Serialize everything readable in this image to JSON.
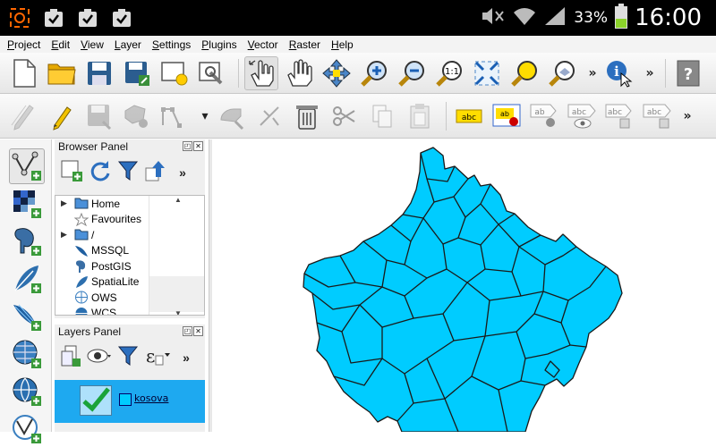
{
  "status_bar": {
    "time": "16:00",
    "battery_percent": "33%",
    "icons": [
      "gps-icon",
      "clipboard-icon",
      "clipboard-icon",
      "clipboard-icon",
      "mute-icon",
      "wifi-icon",
      "signal-icon",
      "battery-icon"
    ]
  },
  "menu": {
    "items": [
      {
        "label": "Project"
      },
      {
        "label": "Edit"
      },
      {
        "label": "View"
      },
      {
        "label": "Layer"
      },
      {
        "label": "Settings"
      },
      {
        "label": "Plugins"
      },
      {
        "label": "Vector"
      },
      {
        "label": "Raster"
      },
      {
        "label": "Help"
      }
    ]
  },
  "toolbar1": {
    "buttons": [
      "new-project-icon",
      "open-project-icon",
      "save-project-icon",
      "save-as-icon",
      "new-print-composer-icon",
      "composer-manager-icon",
      "touch-zoom-icon",
      "pan-icon",
      "pan-to-selection-icon",
      "zoom-in-icon",
      "zoom-out-icon",
      "zoom-actual-size-icon",
      "zoom-full-icon",
      "zoom-to-selection-icon",
      "zoom-to-layer-icon",
      "identify-icon",
      "help-icon"
    ],
    "more_label": "»"
  },
  "toolbar2": {
    "buttons": [
      "current-edits-icon",
      "toggle-editing-icon",
      "save-edits-icon",
      "add-feature-icon",
      "move-feature-icon",
      "node-tool-icon",
      "delete-selected-icon",
      "cut-features-icon",
      "copy-features-icon",
      "paste-features-icon",
      "label-icon",
      "layer-labeling-icon",
      "pin-labels-icon",
      "show-hide-labels-icon",
      "move-label-icon",
      "rotate-label-icon"
    ],
    "more_label": "»"
  },
  "left_toolbar": {
    "buttons": [
      "add-vector-layer-icon",
      "add-raster-layer-icon",
      "add-postgis-layer-icon",
      "add-spatialite-layer-icon",
      "add-mssql-layer-icon",
      "add-wms-layer-icon",
      "add-wcs-layer-icon",
      "add-wfs-layer-icon"
    ]
  },
  "browser_panel": {
    "title": "Browser Panel",
    "more_label": "»",
    "items": [
      {
        "label": "Home",
        "icon": "folder-icon",
        "expandable": true
      },
      {
        "label": "Favourites",
        "icon": "star-icon",
        "expandable": false
      },
      {
        "label": "/",
        "icon": "folder-icon",
        "expandable": true
      },
      {
        "label": "MSSQL",
        "icon": "mssql-icon",
        "expandable": false
      },
      {
        "label": "PostGIS",
        "icon": "postgis-icon",
        "expandable": false
      },
      {
        "label": "SpatiaLite",
        "icon": "spatialite-icon",
        "expandable": false
      },
      {
        "label": "OWS",
        "icon": "ows-icon",
        "expandable": false
      },
      {
        "label": "WCS",
        "icon": "wcs-icon",
        "expandable": false
      }
    ]
  },
  "layers_panel": {
    "title": "Layers Panel",
    "more_label": "»",
    "layers": [
      {
        "name": "kosova",
        "visible": true,
        "fill_color": "#00ccff"
      }
    ]
  },
  "map": {
    "fill_color": "#00ccff",
    "stroke_color": "#1a1a1a"
  }
}
